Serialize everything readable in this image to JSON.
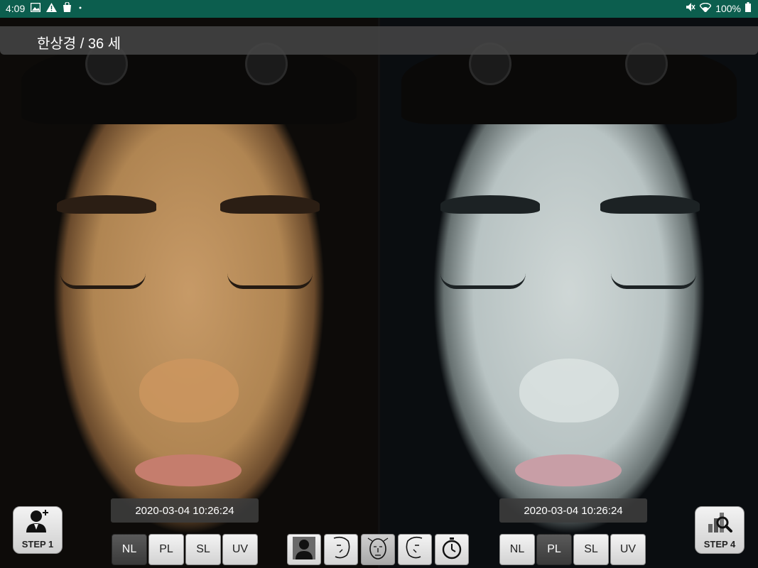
{
  "status_bar": {
    "time": "4:09",
    "battery": "100%",
    "icons_left": [
      "image-icon",
      "alert-icon",
      "bag-icon",
      "dot-icon"
    ],
    "icons_right": [
      "mute-icon",
      "wifi-icon",
      "battery-icon"
    ]
  },
  "header": {
    "patient": "한상경 / 36 세"
  },
  "left_panel": {
    "timestamp": "2020-03-04 10:26:24",
    "modes": [
      "NL",
      "PL",
      "SL",
      "UV"
    ],
    "active_mode": "NL"
  },
  "right_panel": {
    "timestamp": "2020-03-04 10:26:24",
    "modes": [
      "NL",
      "PL",
      "SL",
      "UV"
    ],
    "active_mode": "PL"
  },
  "step1": {
    "label": "STEP 1",
    "icon": "add-user-icon"
  },
  "step4": {
    "label": "STEP 4",
    "icon": "chart-search-icon"
  },
  "view_buttons": [
    "user-profile-icon",
    "face-left-icon",
    "face-front-icon",
    "face-right-icon",
    "timer-icon"
  ],
  "active_view": "face-front-icon",
  "colors": {
    "status_bar": "#0c5e4e",
    "header": "#464646",
    "active_mode": "#4a4a4a"
  }
}
